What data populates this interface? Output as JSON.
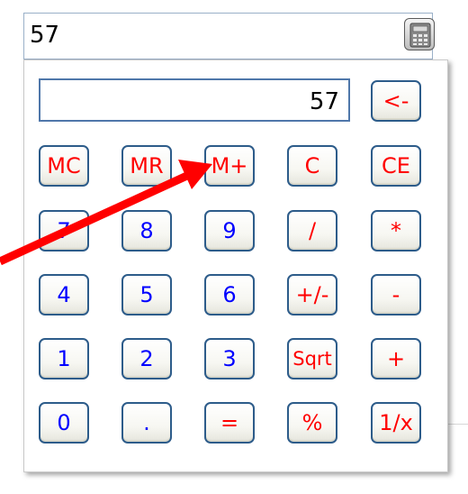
{
  "combo": {
    "value": "57",
    "calculator_icon": "calculator-icon"
  },
  "calculator": {
    "display_value": "57",
    "rows": [
      [
        {
          "label": "MC",
          "color": "red",
          "name": "mc"
        },
        {
          "label": "MR",
          "color": "red",
          "name": "mr"
        },
        {
          "label": "M+",
          "color": "red",
          "name": "m-plus"
        },
        {
          "label": "C",
          "color": "red",
          "name": "clear"
        },
        {
          "label": "CE",
          "color": "red",
          "name": "clear-entry"
        }
      ],
      [
        {
          "label": "7",
          "color": "blue",
          "name": "digit-7"
        },
        {
          "label": "8",
          "color": "blue",
          "name": "digit-8"
        },
        {
          "label": "9",
          "color": "blue",
          "name": "digit-9"
        },
        {
          "label": "/",
          "color": "red",
          "name": "divide"
        },
        {
          "label": "*",
          "color": "red",
          "name": "multiply"
        }
      ],
      [
        {
          "label": "4",
          "color": "blue",
          "name": "digit-4"
        },
        {
          "label": "5",
          "color": "blue",
          "name": "digit-5"
        },
        {
          "label": "6",
          "color": "blue",
          "name": "digit-6"
        },
        {
          "label": "+/-",
          "color": "red",
          "name": "negate"
        },
        {
          "label": "-",
          "color": "red",
          "name": "subtract"
        }
      ],
      [
        {
          "label": "1",
          "color": "blue",
          "name": "digit-1"
        },
        {
          "label": "2",
          "color": "blue",
          "name": "digit-2"
        },
        {
          "label": "3",
          "color": "blue",
          "name": "digit-3"
        },
        {
          "label": "Sqrt",
          "color": "red",
          "name": "sqrt"
        },
        {
          "label": "+",
          "color": "red",
          "name": "add"
        }
      ],
      [
        {
          "label": "0",
          "color": "blue",
          "name": "digit-0"
        },
        {
          "label": ".",
          "color": "blue",
          "name": "decimal"
        },
        {
          "label": "=",
          "color": "red",
          "name": "equals"
        },
        {
          "label": "%",
          "color": "red",
          "name": "percent"
        },
        {
          "label": "1/x",
          "color": "red",
          "name": "reciprocal"
        }
      ]
    ],
    "backspace": {
      "label": "<-",
      "color": "red"
    }
  },
  "colors": {
    "key_border": "#2d5c8a",
    "blue_text": "#0000ff",
    "red_text": "#ff0000",
    "annotation_arrow": "#ff0000"
  },
  "annotation": {
    "type": "arrow",
    "points_to": "m-plus-button"
  }
}
